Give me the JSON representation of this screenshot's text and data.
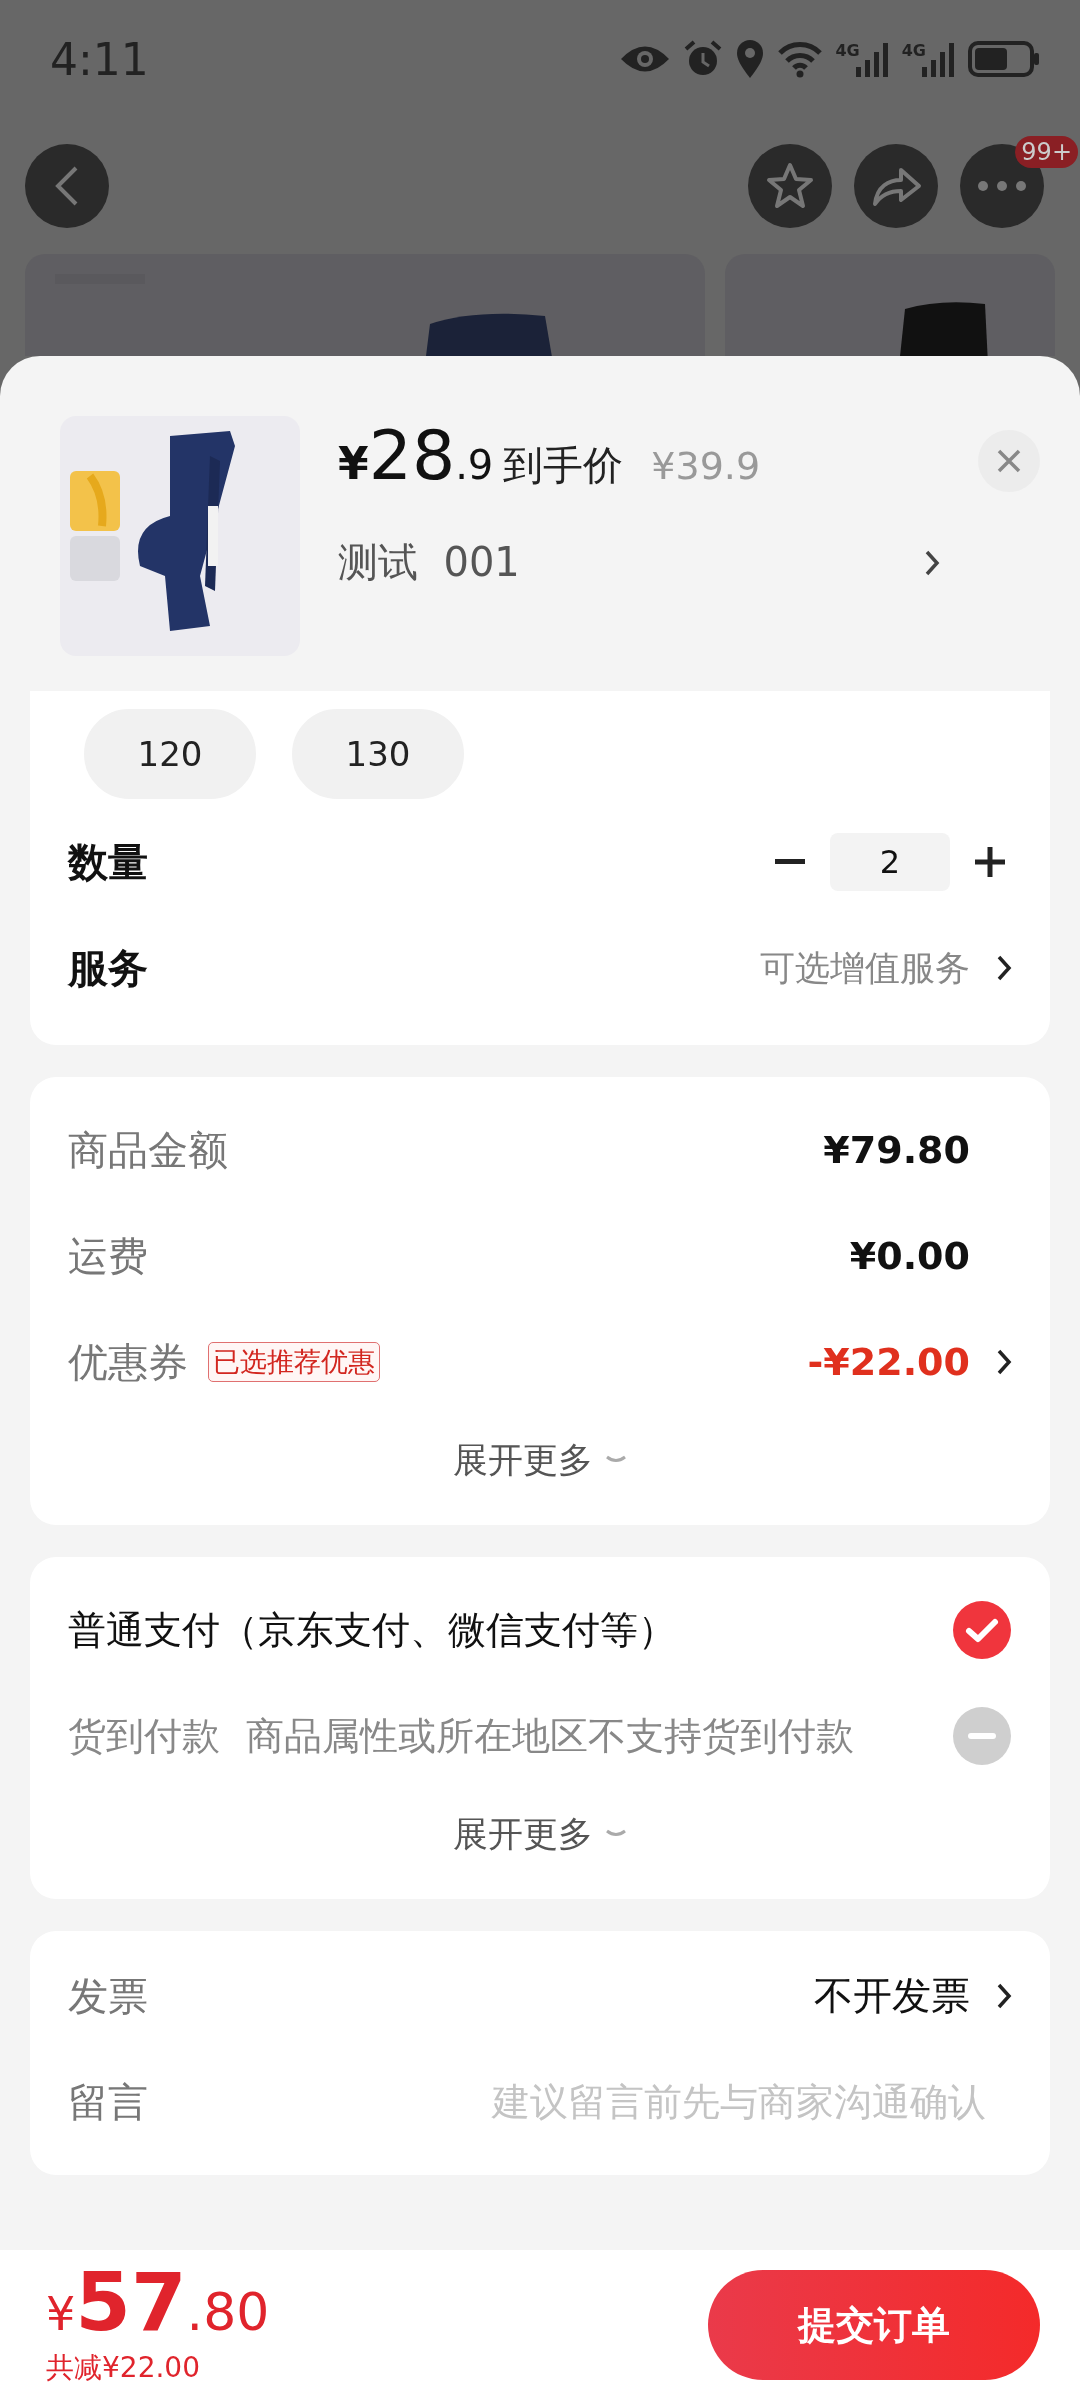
{
  "status_bar": {
    "time": "4:11",
    "networks": [
      "4G",
      "4G"
    ]
  },
  "header": {
    "more_badge": "99+"
  },
  "sheet": {
    "price": {
      "currency": "¥",
      "integer": "28",
      "decimal": ".9",
      "label": "到手价",
      "original": "¥39.9"
    },
    "variant": "测试  001",
    "sizes": [
      {
        "label": "120",
        "selected": false
      },
      {
        "label": "130",
        "selected": false
      }
    ],
    "quantity": {
      "label": "数量",
      "value": "2"
    },
    "service": {
      "label": "服务",
      "value": "可选增值服务"
    },
    "summary": [
      {
        "kind": "plain",
        "label": "商品金额",
        "value": "¥79.80"
      },
      {
        "kind": "plain",
        "label": "运费",
        "value": "¥0.00"
      },
      {
        "kind": "coupon",
        "label": "优惠券",
        "tag": "已选推荐优惠",
        "value": "-¥22.00"
      }
    ],
    "summary_expand": "展开更多",
    "payment": [
      {
        "label": "普通支付（京东支付、微信支付等）",
        "selected": true,
        "disabled": false
      },
      {
        "label": "货到付款",
        "note": "商品属性或所在地区不支持货到付款",
        "selected": false,
        "disabled": true
      }
    ],
    "payment_expand": "展开更多",
    "invoice": {
      "label": "发票",
      "value": "不开发票"
    },
    "message": {
      "label": "留言",
      "placeholder": "建议留言前先与商家沟通确认"
    }
  },
  "footer": {
    "currency": "¥",
    "integer": "57",
    "decimal": ".80",
    "discount": "共减¥22.00",
    "submit": "提交订单"
  }
}
